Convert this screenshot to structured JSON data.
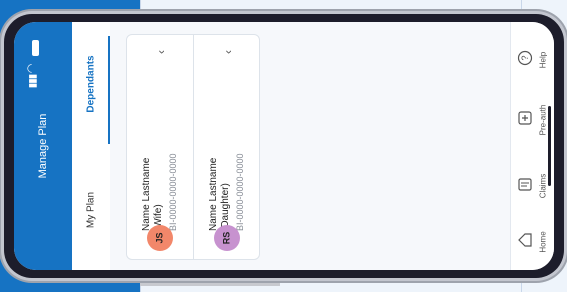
{
  "header": {
    "title": "Manage Plan"
  },
  "tabs": [
    {
      "label": "My Plan",
      "active": false
    },
    {
      "label": "Dependants",
      "active": true
    }
  ],
  "dependants": [
    {
      "initials": "JS",
      "name": "Name Lastname",
      "relation": "(Wife)",
      "id": "BI-0000-0000-0000",
      "avatar_color": "#f2876a"
    },
    {
      "initials": "RS",
      "name": "Name Lastname",
      "relation": "(Daughter)",
      "id": "BI-0000-0000-0000",
      "avatar_color": "#c792cf"
    }
  ],
  "nav": [
    {
      "label": "Help",
      "icon": "help-icon"
    },
    {
      "label": "Pre-auth",
      "icon": "preauth-icon"
    },
    {
      "label": "Claims",
      "icon": "claims-icon"
    },
    {
      "label": "Home",
      "icon": "home-icon"
    }
  ],
  "colors": {
    "brand": "#1673c3"
  }
}
